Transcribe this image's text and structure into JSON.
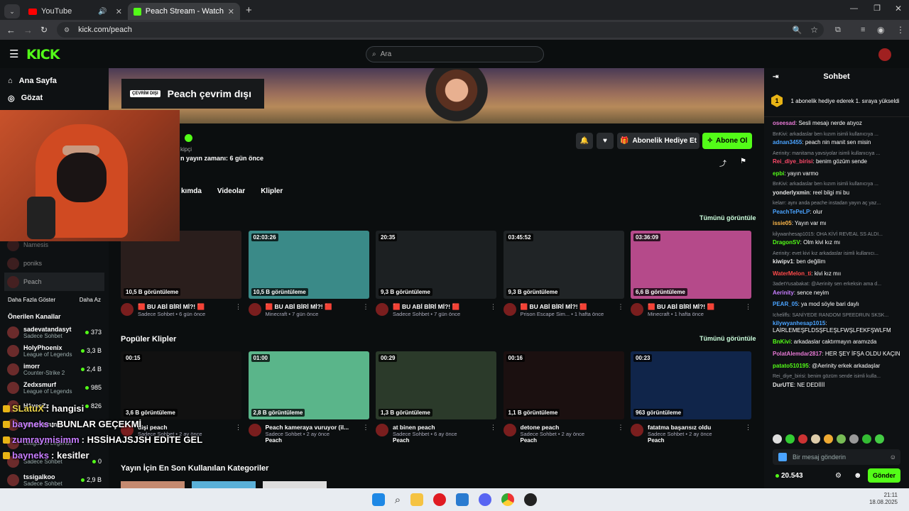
{
  "browser": {
    "tabs": [
      {
        "label": "YouTube",
        "active": false
      },
      {
        "label": "Peach Stream - Watch Live on K",
        "active": true
      }
    ],
    "url": "kick.com/peach"
  },
  "kick": {
    "search_placeholder": "Ara",
    "nav": [
      {
        "label": "Ana Sayfa",
        "icon": "home-icon"
      },
      {
        "label": "Gözat",
        "icon": "compass-icon"
      }
    ],
    "following_partial": [
      {
        "name": "Namesis"
      },
      {
        "name": "poniks"
      },
      {
        "name": "Peach"
      }
    ],
    "show_more": "Daha Fazla Göster",
    "show_less": "Daha Az",
    "recommended_title": "Önerilen Kanallar",
    "recommended": [
      {
        "name": "sadevatandasyt",
        "category": "Sadece Sohbet",
        "viewers": "373"
      },
      {
        "name": "HolyPhoenix",
        "category": "League of Legends",
        "viewers": "3,3 B"
      },
      {
        "name": "imorr",
        "category": "Counter-Strike 2",
        "viewers": "2,4 B"
      },
      {
        "name": "Zedxsmurf",
        "category": "League of Legends",
        "viewers": "985"
      },
      {
        "name": "H1vezZz",
        "category": "",
        "viewers": "826"
      },
      {
        "name": "erhanturunc",
        "category": "",
        "viewers": ""
      },
      {
        "name": "",
        "category": "League of Legends",
        "viewers": ""
      },
      {
        "name": "",
        "category": "Sadece Sohbet",
        "viewers": "0"
      },
      {
        "name": "tssigalkoo",
        "category": "Sadece Sohbet",
        "viewers": "2,9 B"
      }
    ],
    "channel": {
      "offline_tag": "ÇEVRİM DIŞI",
      "offline_title": "Peach çevrim dışı",
      "status_partial": "kipçi",
      "last_live": "n yayın zamanı: 6 gün önce",
      "gift_sub": "Abonelik Hediye Et",
      "subscribe": "Abone Ol",
      "tabs": [
        "kımda",
        "Videolar",
        "Klipler"
      ]
    },
    "see_all": "Tümünü görüntüle",
    "videos": [
      {
        "duration": "",
        "views": "10,5 B görüntüleme",
        "title": "🟥 BU ABİ BİRİ Mİ?! 🟥",
        "sub": "Sadece Sohbet • 6 gün önce",
        "color": "#2a1e1c"
      },
      {
        "duration": "02:03:26",
        "views": "10,5 B görüntüleme",
        "title": "🟥 BU ABİ BİRİ Mİ?! 🟥",
        "sub": "Minecraft • 7 gün önce",
        "color": "#3a8a88"
      },
      {
        "duration": "20:35",
        "views": "9,3 B görüntüleme",
        "title": "🟥 BU ABİ BİRİ Mİ?! 🟥",
        "sub": "Sadece Sohbet • 7 gün önce",
        "color": "#1c2022"
      },
      {
        "duration": "03:45:52",
        "views": "9,3 B görüntüleme",
        "title": "🟥 BU ABİ BİRİ Mİ?! 🟥",
        "sub": "Prison Escape Sim... • 1 hafta önce",
        "color": "#202426"
      },
      {
        "duration": "03:36:09",
        "views": "6,6 B görüntüleme",
        "title": "🟥 BU ABİ BİRİ Mİ?! 🟥",
        "sub": "Minecraft • 1 hafta önce",
        "color": "#b54a8a"
      }
    ],
    "clips_title": "Popüler Klipler",
    "clips": [
      {
        "duration": "00:15",
        "views": "3,6 B görüntüleme",
        "title": "dişi peach",
        "sub": "Sadece Sohbet • 2 ay önce",
        "author": "",
        "color": "#111"
      },
      {
        "duration": "01:00",
        "views": "2,8 B görüntüleme",
        "title": "Peach kameraya vuruyor (il...",
        "sub": "Sadece Sohbet • 2 ay önce",
        "author": "Peach",
        "color": "#5ab58a"
      },
      {
        "duration": "00:29",
        "views": "1,3 B görüntüleme",
        "title": "at binen peach",
        "sub": "Sadece Sohbet • 6 ay önce",
        "author": "Peach",
        "color": "#2b3a2a"
      },
      {
        "duration": "00:16",
        "views": "1,1 B görüntüleme",
        "title": "detone peach",
        "sub": "Sadece Sohbet • 2 ay önce",
        "author": "Peach",
        "color": "#1b1010"
      },
      {
        "duration": "00:23",
        "views": "963 görüntüleme",
        "title": "fatatma başarısız oldu",
        "sub": "Sadece Sohbet • 2 ay önce",
        "author": "Peach",
        "color": "#10254a"
      }
    ],
    "categories_title": "Yayın İçin En Son Kullanılan Kategoriler"
  },
  "chat": {
    "title": "Sohbet",
    "pinned": "1 abonelik hediye ederek 1. sıraya yükseldi",
    "pinned_rank": "1",
    "messages": [
      {
        "reply": "",
        "user": "oseesad",
        "color": "#e87ad6",
        "text": "Sesli mesajı nerde atıyoz"
      },
      {
        "reply": "BnKivi: arkadaslar ben kızım isimli kullanıcıya ...",
        "user": "adnan3455",
        "color": "#4aa3ff",
        "text": "peach nin manit sen misin"
      },
      {
        "reply": "Aerinity: manitama yavsiyolar isimli kullanıcıya ...",
        "user": "Rei_diye_birisi",
        "color": "#ff4a6a",
        "text": "benim gözüm sende"
      },
      {
        "reply": "",
        "user": "epbi",
        "color": "#53fc18",
        "text": "yayın varmo"
      },
      {
        "reply": "BnKivi: arkadaslar ben kızım isimli kullanıcıya ...",
        "user": "yonderlyxmin",
        "color": "#e8e8e8",
        "text": "reel bilgi mi bu"
      },
      {
        "reply": "kelarr: aynı anda peache instadan yayın aç yaz...",
        "user": "PeachTePeLP",
        "color": "#4aa3ff",
        "text": "olur"
      },
      {
        "reply": "",
        "user": "issie05",
        "color": "#ffb84a",
        "text": "Yayın var mı"
      },
      {
        "reply": "kilywanhesap1015: OHA KİVİ REVEAL SS ALDI...",
        "user": "DragonSV",
        "color": "#53fc18",
        "text": "Olm kivi kız mı"
      },
      {
        "reply": "Aerinity: evet kivi kız arkadaslar isimli kullanıcı...",
        "user": "kiwipv1",
        "color": "#e8e8e8",
        "text": "ben değilim"
      },
      {
        "reply": "",
        "user": "WaterMelon_ti",
        "color": "#ff4a4a",
        "text": "kivi kız mıı"
      },
      {
        "reply": "3adetYusabakat: @Aerinity sen erkeksin ama d...",
        "user": "Aerinity",
        "color": "#c77dff",
        "text": "sence neyim"
      },
      {
        "reply": "",
        "user": "PEAR_05",
        "color": "#4aa3ff",
        "text": "ya mod söyle bari daylı"
      },
      {
        "reply": "Icheliffs: SANİYEDE RANDOM SPEEDRUN SKSK...",
        "user": "kilywyanhesap1015",
        "color": "#4aa3ff",
        "text": "LAİRLEMEŞFLDSŞFLEŞLFWŞLFEKFŞWLFM"
      },
      {
        "reply": "",
        "user": "BnKivi",
        "color": "#53fc18",
        "text": "arkadaslar caktırmayın aramızda"
      },
      {
        "reply": "",
        "user": "PolatAlemdar2817",
        "color": "#e87ad6",
        "text": "HER ŞEY İFŞA OLDU KAÇIN"
      },
      {
        "reply": "",
        "user": "patato510195",
        "color": "#53fc18",
        "text": "@Aerinity erkek arkadaşlar"
      },
      {
        "reply": "Rei_diye_birisi: benim gözüm sende isimli kulla...",
        "user": "DurUTE",
        "color": "#e8e8e8",
        "text": "NE DEDİİİİ"
      }
    ],
    "input_placeholder": "Bir mesaj gönderin",
    "points": "20.543",
    "send": "Gönder"
  },
  "overlay_chat": [
    {
      "user": "SLatuX",
      "text": ": hangisi",
      "color": "#e8d24a"
    },
    {
      "user": "bayneks",
      "text": ": BUNLAR GEÇEKMİ",
      "color": "#c77dff"
    },
    {
      "user": "zumraymisimm",
      "text": ": HSSİHAJSJSH EDİTE GEL",
      "color": "#c77dff"
    },
    {
      "user": "bayneks",
      "text": ": kesitler",
      "color": "#c77dff"
    }
  ],
  "taskbar": {
    "time": "21:11",
    "date": "18.08.2025"
  }
}
